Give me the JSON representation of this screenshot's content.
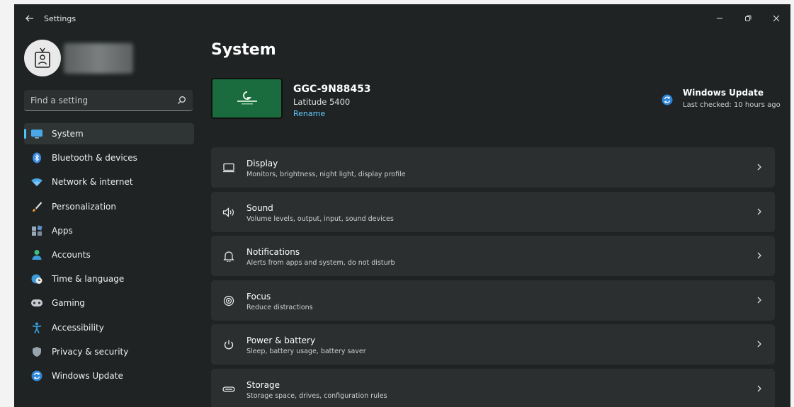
{
  "window": {
    "title": "Settings"
  },
  "search": {
    "placeholder": "Find a setting"
  },
  "sidebar": {
    "items": [
      {
        "label": "System",
        "icon": "monitor-icon",
        "active": true
      },
      {
        "label": "Bluetooth & devices",
        "icon": "bluetooth-icon"
      },
      {
        "label": "Network & internet",
        "icon": "wifi-icon"
      },
      {
        "label": "Personalization",
        "icon": "brush-icon"
      },
      {
        "label": "Apps",
        "icon": "apps-icon"
      },
      {
        "label": "Accounts",
        "icon": "person-icon"
      },
      {
        "label": "Time & language",
        "icon": "globe-clock-icon"
      },
      {
        "label": "Gaming",
        "icon": "gamepad-icon"
      },
      {
        "label": "Accessibility",
        "icon": "accessibility-icon"
      },
      {
        "label": "Privacy & security",
        "icon": "shield-icon"
      },
      {
        "label": "Windows Update",
        "icon": "update-icon"
      }
    ]
  },
  "main": {
    "title": "System",
    "device": {
      "name": "GGC-9N88453",
      "model": "Latitude 5400",
      "rename_label": "Rename"
    },
    "windows_update": {
      "title": "Windows Update",
      "status": "Last checked: 10 hours ago"
    },
    "cards": [
      {
        "title": "Display",
        "desc": "Monitors, brightness, night light, display profile",
        "icon": "display-icon"
      },
      {
        "title": "Sound",
        "desc": "Volume levels, output, input, sound devices",
        "icon": "speaker-icon"
      },
      {
        "title": "Notifications",
        "desc": "Alerts from apps and system, do not disturb",
        "icon": "bell-icon"
      },
      {
        "title": "Focus",
        "desc": "Reduce distractions",
        "icon": "focus-icon"
      },
      {
        "title": "Power & battery",
        "desc": "Sleep, battery usage, battery saver",
        "icon": "power-icon"
      },
      {
        "title": "Storage",
        "desc": "Storage space, drives, configuration rules",
        "icon": "storage-icon"
      }
    ]
  },
  "colors": {
    "accent": "#4cc2ff",
    "link": "#62c9ff",
    "background": "#1f2323",
    "card": "#2b2f2f"
  }
}
